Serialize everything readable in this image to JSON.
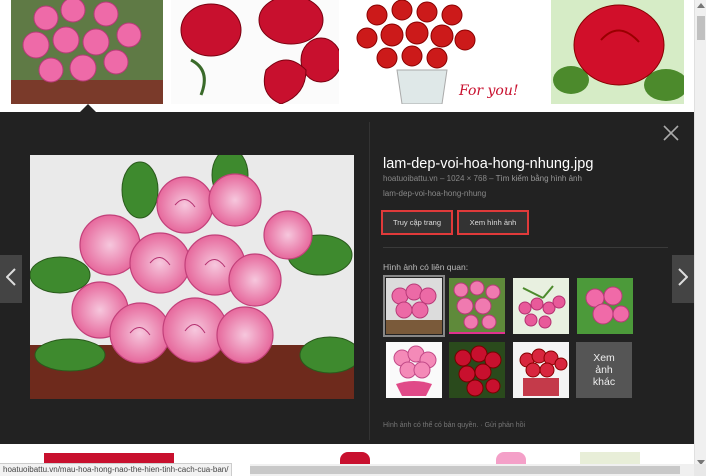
{
  "preview": {
    "filename": "lam-dep-voi-hoa-hong-nhung.jpg",
    "site": "hoatuoibattu.vn",
    "dimensions": "1024 × 768",
    "reverse_search_link": "Tìm kiếm bằng hình ảnh",
    "subname": "lam-dep-voi-hoa-hong-nhung",
    "visit_page_button": "Truy cập trang",
    "view_image_button": "Xem hình ảnh",
    "related_label": "Hình ảnh có liên quan:",
    "more_images_label": "Xem ảnh khác",
    "copyright_note": "Hình ảnh có thể có bản quyền.",
    "feedback_link": "Gửi phản hồi"
  },
  "top_thumbnails": [
    "pink-roses",
    "red-roses-heart",
    "red-roses-vase-for-you",
    "red-rose-single"
  ],
  "for_you_text": "For you!",
  "related_images": [
    "pink-roses-basket",
    "pink-roses-bouquet",
    "pink-roses-field",
    "pink-roses-bunch",
    "pink-roses-ribbon",
    "red-roses-bouquet",
    "red-roses-box"
  ],
  "status_bar": {
    "url": "hoatuoibattu.vn/mau-hoa-hong-nao-the-hien-tinh-cach-cua-ban/"
  },
  "colors": {
    "panel_bg": "#222222",
    "button_highlight": "#e03a3a",
    "rose_pink": "#e85a9a",
    "rose_red": "#c8102e"
  }
}
